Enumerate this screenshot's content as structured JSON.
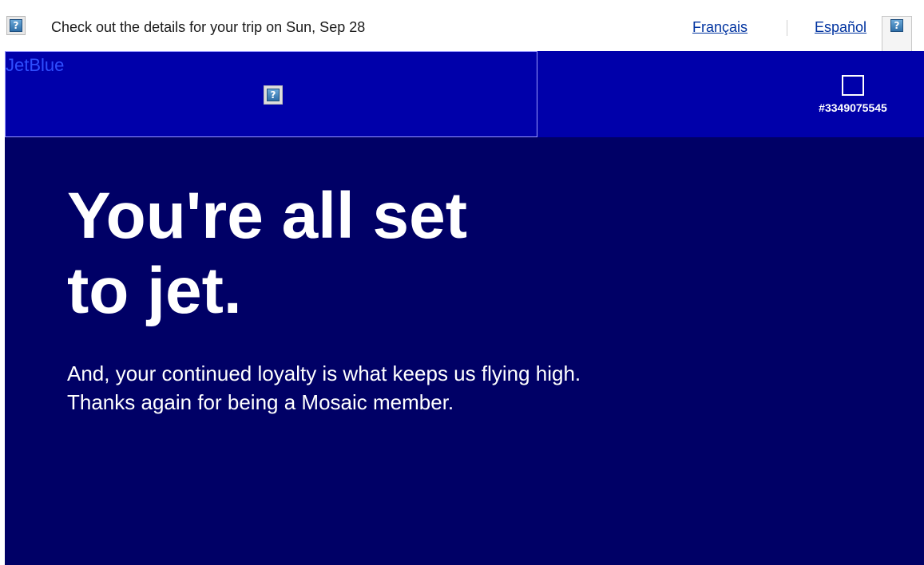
{
  "topbar": {
    "preheader": "Check out the details for your trip on Sun, Sep 28",
    "lang_fr": "Français",
    "lang_es": "Español",
    "broken_image_icon": "broken-image-icon"
  },
  "nav": {
    "logo_alt": "JetBlue",
    "member_number": "#3349075545"
  },
  "hero": {
    "headline": "You're all set to jet.",
    "body": "And, your continued loyalty is what keeps us flying high. Thanks again for being a Mosaic member."
  },
  "colors": {
    "nav_bg": "#0000aa",
    "hero_bg": "#000066",
    "link": "#0033a0"
  }
}
